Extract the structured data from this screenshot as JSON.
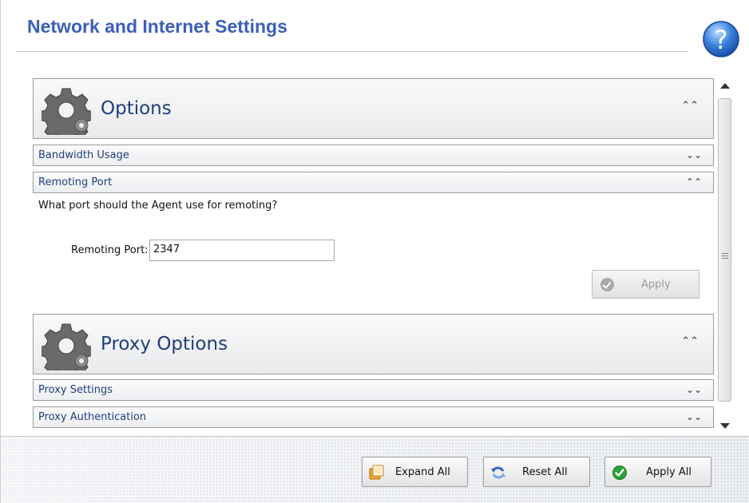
{
  "header": {
    "title": "Network and Internet Settings"
  },
  "icons": {
    "help": "help-question-icon",
    "section": "gear-icon",
    "collapse": "chevron-double-up-icon",
    "expand": "chevron-double-down-icon"
  },
  "sections": {
    "options": {
      "title": "Options",
      "chevron": "≈"
    },
    "bandwidth": {
      "title": "Bandwidth Usage",
      "chevron": "¥"
    },
    "remoting": {
      "title": "Remoting Port",
      "chevron": "≈",
      "question": "What port should the Agent use for remoting?",
      "port_label": "Remoting Port:",
      "port_value": "2347",
      "apply_label": "Apply"
    },
    "proxy_options": {
      "title": "Proxy Options",
      "chevron": "≈"
    },
    "proxy_settings": {
      "title": "Proxy Settings",
      "chevron": "¥"
    },
    "proxy_auth": {
      "title": "Proxy Authentication",
      "chevron": "¥"
    }
  },
  "footer": {
    "expand_all": "Expand All",
    "reset_all": "Reset All",
    "apply_all": "Apply All"
  },
  "colors": {
    "title": "#3a5fb6",
    "section_text": "#1f3e7c",
    "apply_all_icon": "#2fa23a"
  }
}
